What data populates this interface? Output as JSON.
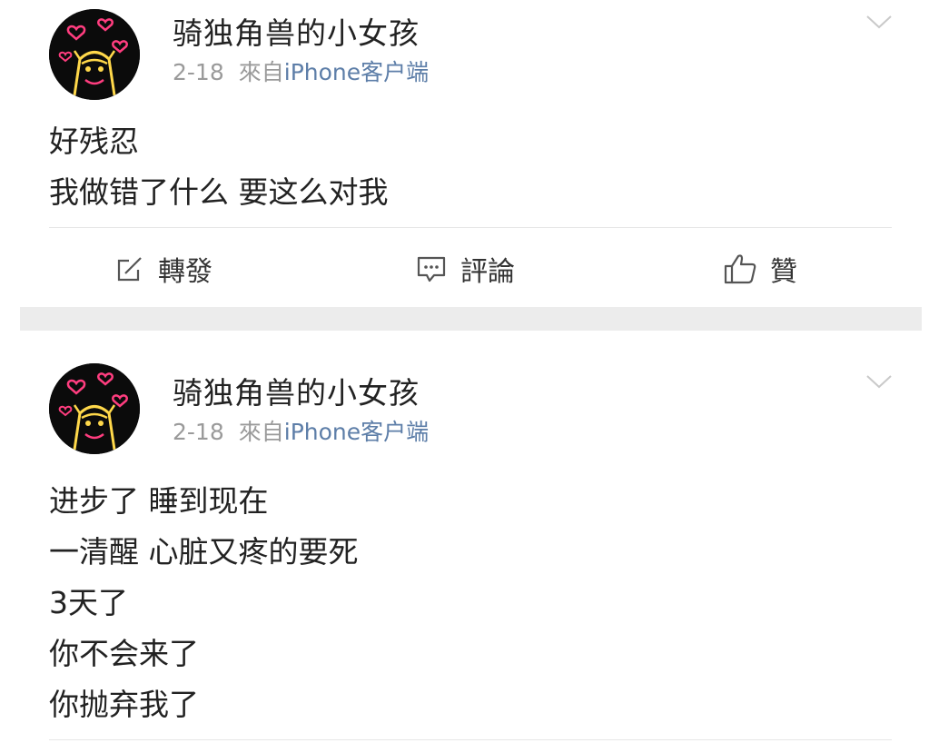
{
  "posts": [
    {
      "author": "骑独角兽的小女孩",
      "date": "2-18",
      "source_prefix": "來自",
      "source": "iPhone客户端",
      "lines": [
        "好残忍",
        "我做错了什么 要这么对我"
      ],
      "actions": {
        "repost": "轉發",
        "comment": "評論",
        "like": "贊"
      }
    },
    {
      "author": "骑独角兽的小女孩",
      "date": "2-18",
      "source_prefix": "來自",
      "source": "iPhone客户端",
      "lines": [
        "进步了 睡到现在",
        "一清醒 心脏又疼的要死",
        "3天了",
        "你不会来了",
        "你抛弃我了"
      ]
    }
  ],
  "icons": {
    "avatar": "neon-bear-hearts-avatar-icon",
    "more": "chevron-down-icon",
    "repost": "compose-arrow-icon",
    "comment": "speech-bubble-icon",
    "like": "thumbs-up-icon"
  },
  "colors": {
    "text": "#222222",
    "meta": "#9a9a9a",
    "source_link": "#5d7ea8",
    "separator": "#ececec",
    "avatar_neon_pink": "#ff3d7f",
    "avatar_neon_yellow": "#ffd84a"
  }
}
